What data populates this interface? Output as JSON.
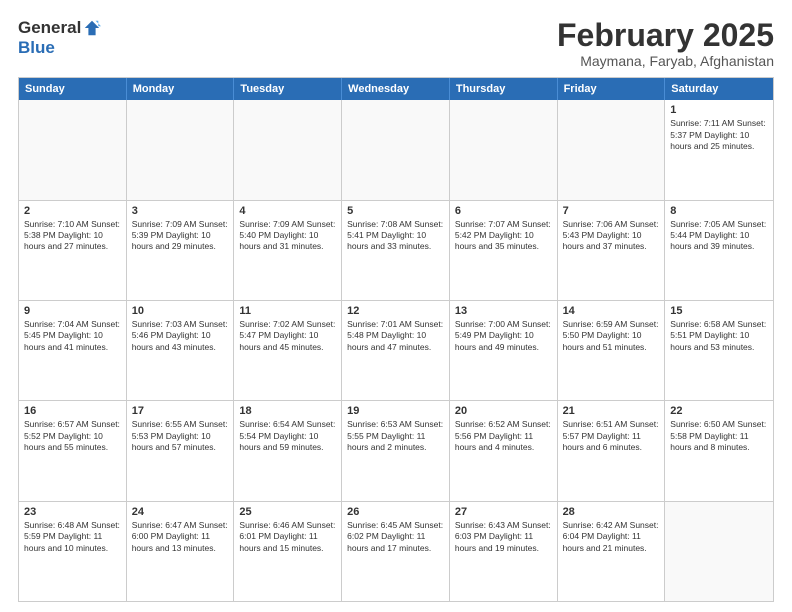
{
  "logo": {
    "general": "General",
    "blue": "Blue"
  },
  "title": "February 2025",
  "subtitle": "Maymana, Faryab, Afghanistan",
  "header_days": [
    "Sunday",
    "Monday",
    "Tuesday",
    "Wednesday",
    "Thursday",
    "Friday",
    "Saturday"
  ],
  "weeks": [
    [
      {
        "day": "",
        "info": ""
      },
      {
        "day": "",
        "info": ""
      },
      {
        "day": "",
        "info": ""
      },
      {
        "day": "",
        "info": ""
      },
      {
        "day": "",
        "info": ""
      },
      {
        "day": "",
        "info": ""
      },
      {
        "day": "1",
        "info": "Sunrise: 7:11 AM\nSunset: 5:37 PM\nDaylight: 10 hours\nand 25 minutes."
      }
    ],
    [
      {
        "day": "2",
        "info": "Sunrise: 7:10 AM\nSunset: 5:38 PM\nDaylight: 10 hours\nand 27 minutes."
      },
      {
        "day": "3",
        "info": "Sunrise: 7:09 AM\nSunset: 5:39 PM\nDaylight: 10 hours\nand 29 minutes."
      },
      {
        "day": "4",
        "info": "Sunrise: 7:09 AM\nSunset: 5:40 PM\nDaylight: 10 hours\nand 31 minutes."
      },
      {
        "day": "5",
        "info": "Sunrise: 7:08 AM\nSunset: 5:41 PM\nDaylight: 10 hours\nand 33 minutes."
      },
      {
        "day": "6",
        "info": "Sunrise: 7:07 AM\nSunset: 5:42 PM\nDaylight: 10 hours\nand 35 minutes."
      },
      {
        "day": "7",
        "info": "Sunrise: 7:06 AM\nSunset: 5:43 PM\nDaylight: 10 hours\nand 37 minutes."
      },
      {
        "day": "8",
        "info": "Sunrise: 7:05 AM\nSunset: 5:44 PM\nDaylight: 10 hours\nand 39 minutes."
      }
    ],
    [
      {
        "day": "9",
        "info": "Sunrise: 7:04 AM\nSunset: 5:45 PM\nDaylight: 10 hours\nand 41 minutes."
      },
      {
        "day": "10",
        "info": "Sunrise: 7:03 AM\nSunset: 5:46 PM\nDaylight: 10 hours\nand 43 minutes."
      },
      {
        "day": "11",
        "info": "Sunrise: 7:02 AM\nSunset: 5:47 PM\nDaylight: 10 hours\nand 45 minutes."
      },
      {
        "day": "12",
        "info": "Sunrise: 7:01 AM\nSunset: 5:48 PM\nDaylight: 10 hours\nand 47 minutes."
      },
      {
        "day": "13",
        "info": "Sunrise: 7:00 AM\nSunset: 5:49 PM\nDaylight: 10 hours\nand 49 minutes."
      },
      {
        "day": "14",
        "info": "Sunrise: 6:59 AM\nSunset: 5:50 PM\nDaylight: 10 hours\nand 51 minutes."
      },
      {
        "day": "15",
        "info": "Sunrise: 6:58 AM\nSunset: 5:51 PM\nDaylight: 10 hours\nand 53 minutes."
      }
    ],
    [
      {
        "day": "16",
        "info": "Sunrise: 6:57 AM\nSunset: 5:52 PM\nDaylight: 10 hours\nand 55 minutes."
      },
      {
        "day": "17",
        "info": "Sunrise: 6:55 AM\nSunset: 5:53 PM\nDaylight: 10 hours\nand 57 minutes."
      },
      {
        "day": "18",
        "info": "Sunrise: 6:54 AM\nSunset: 5:54 PM\nDaylight: 10 hours\nand 59 minutes."
      },
      {
        "day": "19",
        "info": "Sunrise: 6:53 AM\nSunset: 5:55 PM\nDaylight: 11 hours\nand 2 minutes."
      },
      {
        "day": "20",
        "info": "Sunrise: 6:52 AM\nSunset: 5:56 PM\nDaylight: 11 hours\nand 4 minutes."
      },
      {
        "day": "21",
        "info": "Sunrise: 6:51 AM\nSunset: 5:57 PM\nDaylight: 11 hours\nand 6 minutes."
      },
      {
        "day": "22",
        "info": "Sunrise: 6:50 AM\nSunset: 5:58 PM\nDaylight: 11 hours\nand 8 minutes."
      }
    ],
    [
      {
        "day": "23",
        "info": "Sunrise: 6:48 AM\nSunset: 5:59 PM\nDaylight: 11 hours\nand 10 minutes."
      },
      {
        "day": "24",
        "info": "Sunrise: 6:47 AM\nSunset: 6:00 PM\nDaylight: 11 hours\nand 13 minutes."
      },
      {
        "day": "25",
        "info": "Sunrise: 6:46 AM\nSunset: 6:01 PM\nDaylight: 11 hours\nand 15 minutes."
      },
      {
        "day": "26",
        "info": "Sunrise: 6:45 AM\nSunset: 6:02 PM\nDaylight: 11 hours\nand 17 minutes."
      },
      {
        "day": "27",
        "info": "Sunrise: 6:43 AM\nSunset: 6:03 PM\nDaylight: 11 hours\nand 19 minutes."
      },
      {
        "day": "28",
        "info": "Sunrise: 6:42 AM\nSunset: 6:04 PM\nDaylight: 11 hours\nand 21 minutes."
      },
      {
        "day": "",
        "info": ""
      }
    ]
  ]
}
